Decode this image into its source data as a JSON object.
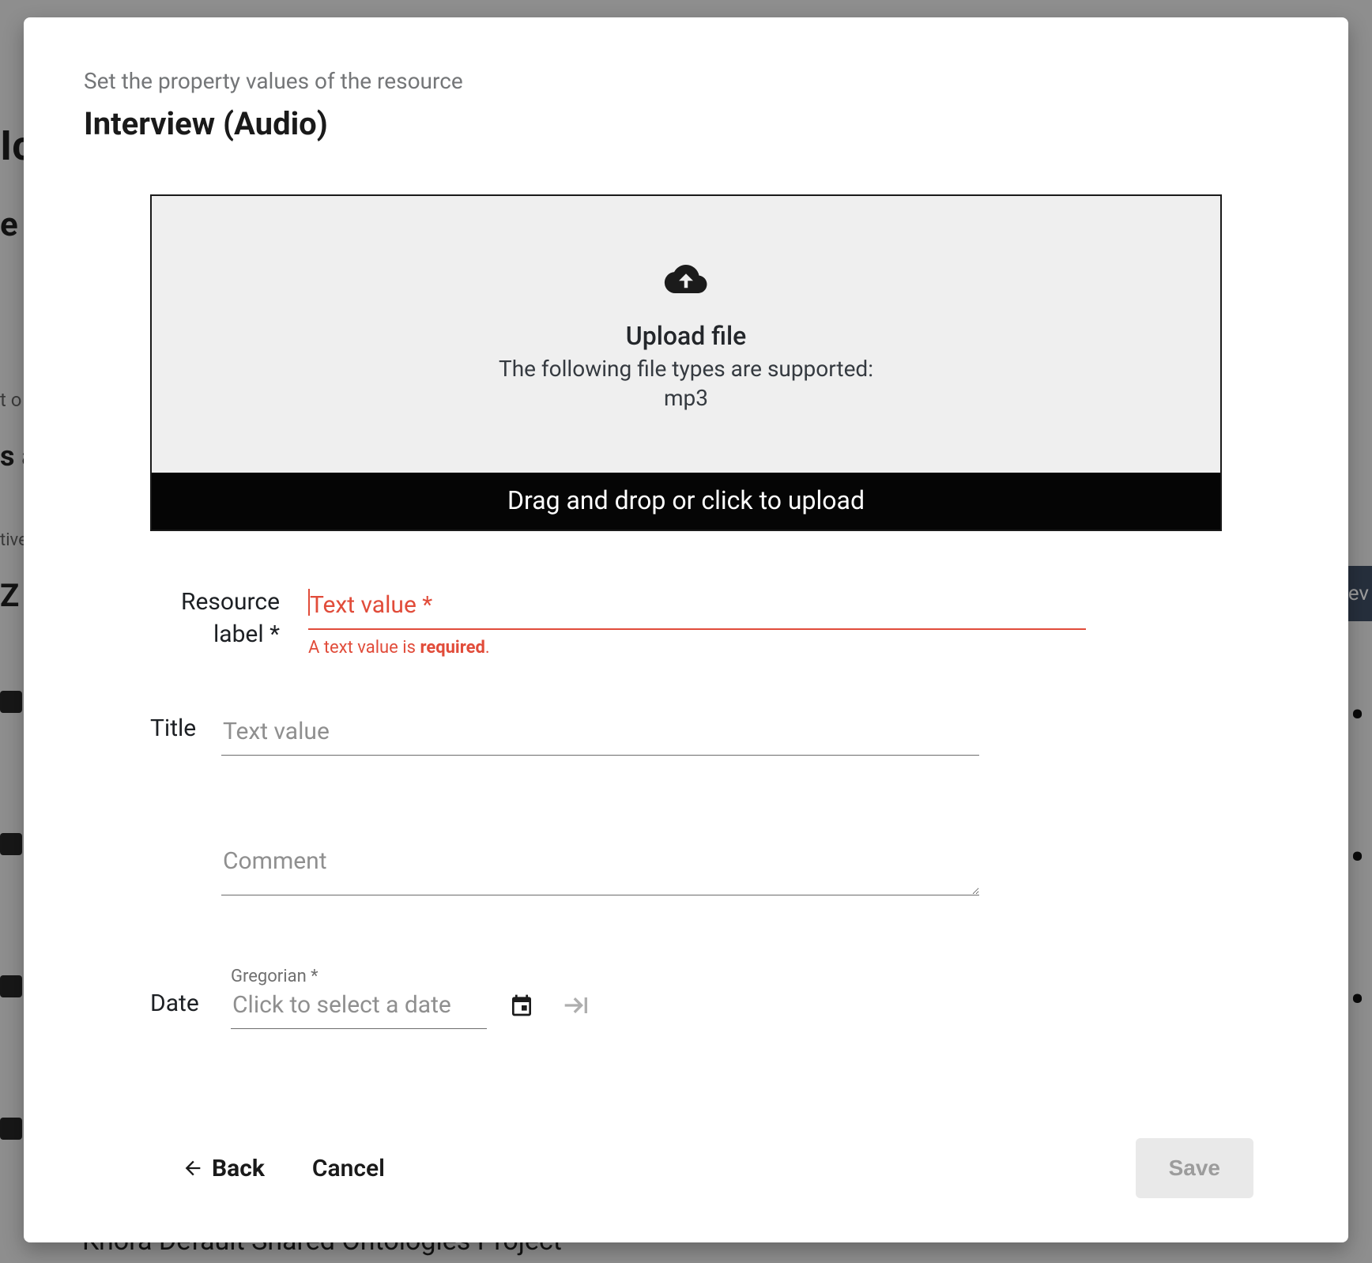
{
  "background": {
    "partial_title_1": "Ic",
    "partial_line_e_y": "e y",
    "partial_line_t_o": "t o",
    "partial_line_s_a": "s a",
    "partial_line_tive": "tive",
    "partial_line_z": "Z",
    "start_button_fragment": "ev",
    "bottom_text": "Knora Default Shared Ontologies Project"
  },
  "modal": {
    "subtitle": "Set the property values of the resource",
    "title": "Interview (Audio)"
  },
  "upload": {
    "title": "Upload file",
    "supported_text": "The following file types are supported:",
    "types": "mp3",
    "bar_text": "Drag and drop or click to upload"
  },
  "fields": {
    "resource_label": {
      "label": "Resource label *",
      "placeholder": "Text value *",
      "error_prefix": "A text value is ",
      "error_bold": "required",
      "error_suffix": "."
    },
    "title": {
      "label": "Title",
      "placeholder": "Text value"
    },
    "comment": {
      "placeholder": "Comment"
    },
    "date": {
      "label": "Date",
      "calendar_label": "Gregorian *",
      "placeholder": "Click to select a date"
    }
  },
  "buttons": {
    "back": "Back",
    "cancel": "Cancel",
    "save": "Save"
  }
}
